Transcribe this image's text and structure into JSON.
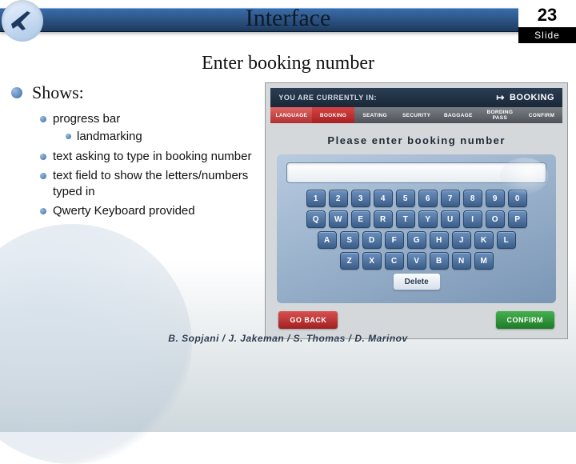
{
  "header": {
    "title": "Interface",
    "page_number": "23",
    "slide_label": "Slide"
  },
  "subtitle": "Enter booking number",
  "shows": {
    "label": "Shows:",
    "items": [
      {
        "text": "progress bar",
        "sub": [
          "landmarking"
        ]
      },
      {
        "text": "text asking to type in booking number"
      },
      {
        "text": "text field to show the letters/numbers typed in"
      },
      {
        "text": "Qwerty Keyboard provided"
      }
    ]
  },
  "kiosk": {
    "topbar_left": "YOU ARE CURRENTLY IN:",
    "topbar_right": "BOOKING",
    "tabs": [
      "LANGUAGE",
      "BOOKING",
      "SEATING",
      "SECURITY",
      "BAGGAGE",
      "BORDING PASS",
      "CONFIRM"
    ],
    "prompt": "Please enter booking number",
    "rows": [
      [
        "1",
        "2",
        "3",
        "4",
        "5",
        "6",
        "7",
        "8",
        "9",
        "0"
      ],
      [
        "Q",
        "W",
        "E",
        "R",
        "T",
        "Y",
        "U",
        "I",
        "O",
        "P"
      ],
      [
        "A",
        "S",
        "D",
        "F",
        "G",
        "H",
        "J",
        "K",
        "L"
      ],
      [
        "Z",
        "X",
        "C",
        "V",
        "B",
        "N",
        "M"
      ]
    ],
    "delete_label": "Delete",
    "go_back": "GO BACK",
    "confirm": "CONFIRM"
  },
  "footer": "B. Sopjani / J. Jakeman / S. Thomas / D. Marinov"
}
